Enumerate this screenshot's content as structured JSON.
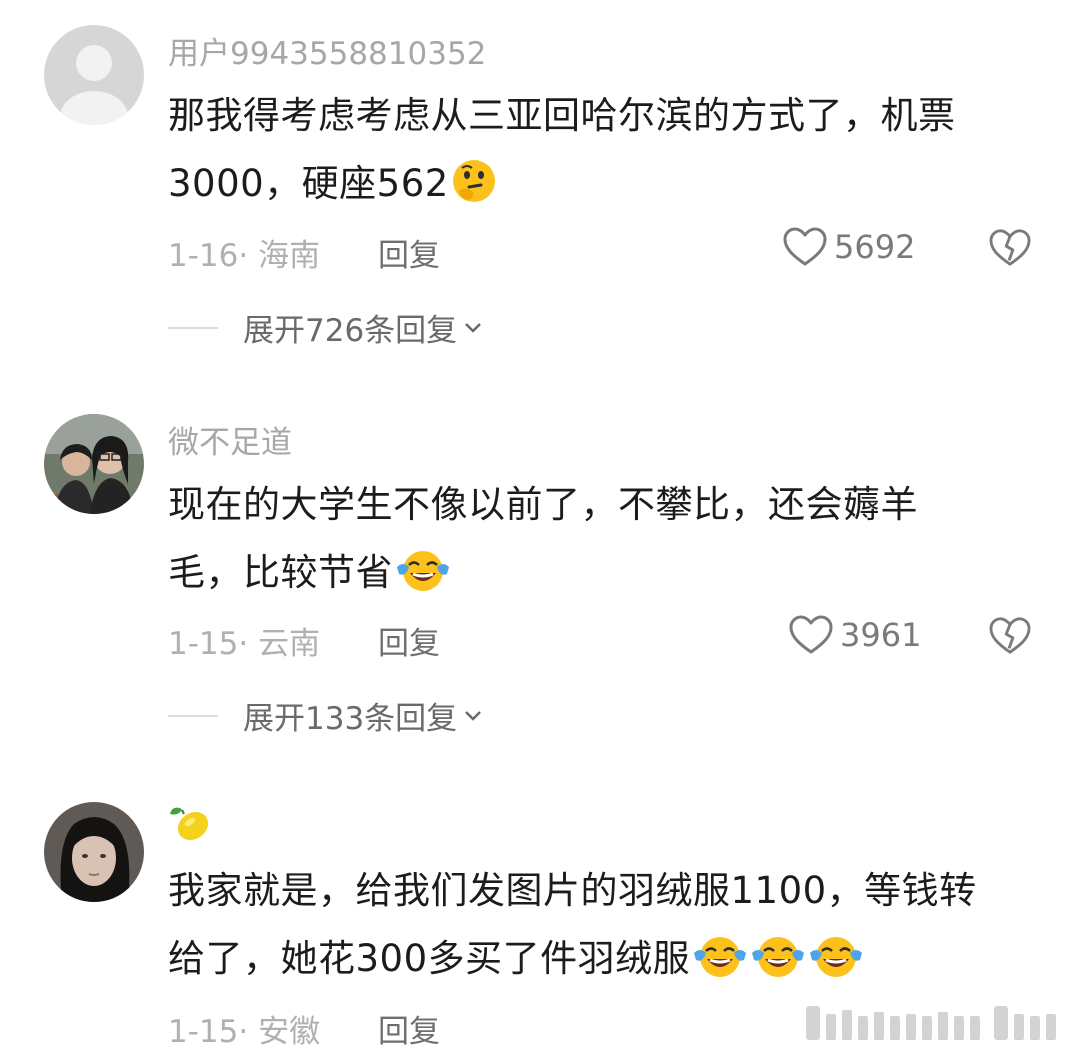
{
  "comments": [
    {
      "username": "用户9943558810352",
      "text_lines": [
        "那我得考虑考虑从三亚回哈尔滨的方式了，机票",
        "3000，硬座562"
      ],
      "emoji": "thinking-face",
      "date": "1-16",
      "location": "海南",
      "reply_label": "回复",
      "likes": "5692",
      "expand_label": "展开726条回复"
    },
    {
      "username": "微不足道",
      "text_lines": [
        "现在的大学生不像以前了，不攀比，还会薅羊",
        "毛，比较节省"
      ],
      "emoji": "crying-laughing-face",
      "date": "1-15",
      "location": "云南",
      "reply_label": "回复",
      "likes": "3961",
      "expand_label": "展开133条回复"
    },
    {
      "username": "🍋",
      "text_lines": [
        "我家就是，给我们发图片的羽绒服1100，等钱转",
        "给了，她花300多买了件羽绒服"
      ],
      "emoji": "crying-laughing-face x3",
      "date": "1-15",
      "location": "安徽",
      "reply_label": "回复"
    }
  ],
  "colors": {
    "username": "#a7a7a7",
    "text": "#1c1c1c",
    "meta": "#b0b0b0",
    "reply": "#6f6f6f"
  }
}
